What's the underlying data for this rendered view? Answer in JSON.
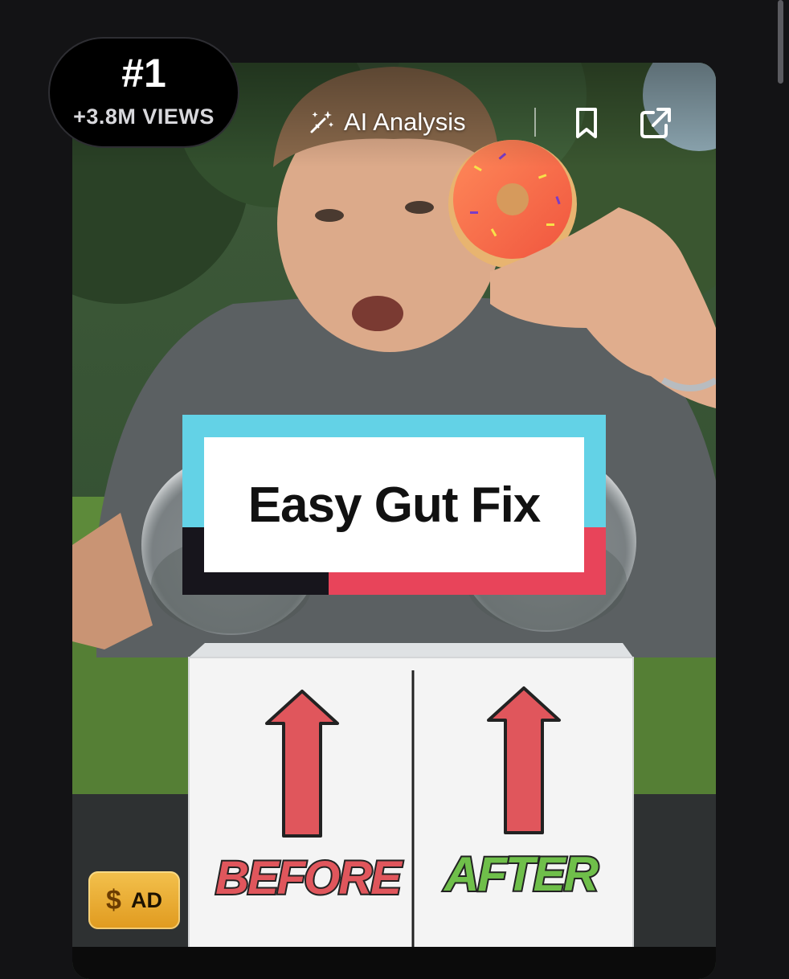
{
  "rank": {
    "number": "#1",
    "views": "+3.8M VIEWS"
  },
  "toolbar": {
    "ai_analysis_label": "AI Analysis",
    "ai_icon": "magic-wand-icon",
    "bookmark_icon": "bookmark-icon",
    "share_icon": "external-link-icon"
  },
  "video": {
    "caption": "Easy Gut Fix",
    "label_before": "BEFORE",
    "label_after": "AFTER"
  },
  "ad_badge": {
    "symbol": "$",
    "label": "AD"
  },
  "colors": {
    "background": "#131315",
    "caption_cyan": "#63d2e6",
    "caption_red": "#e8445a",
    "before_red": "#e0565c",
    "after_green": "#6fbf4a",
    "ad_gold": "#f0b43a"
  }
}
